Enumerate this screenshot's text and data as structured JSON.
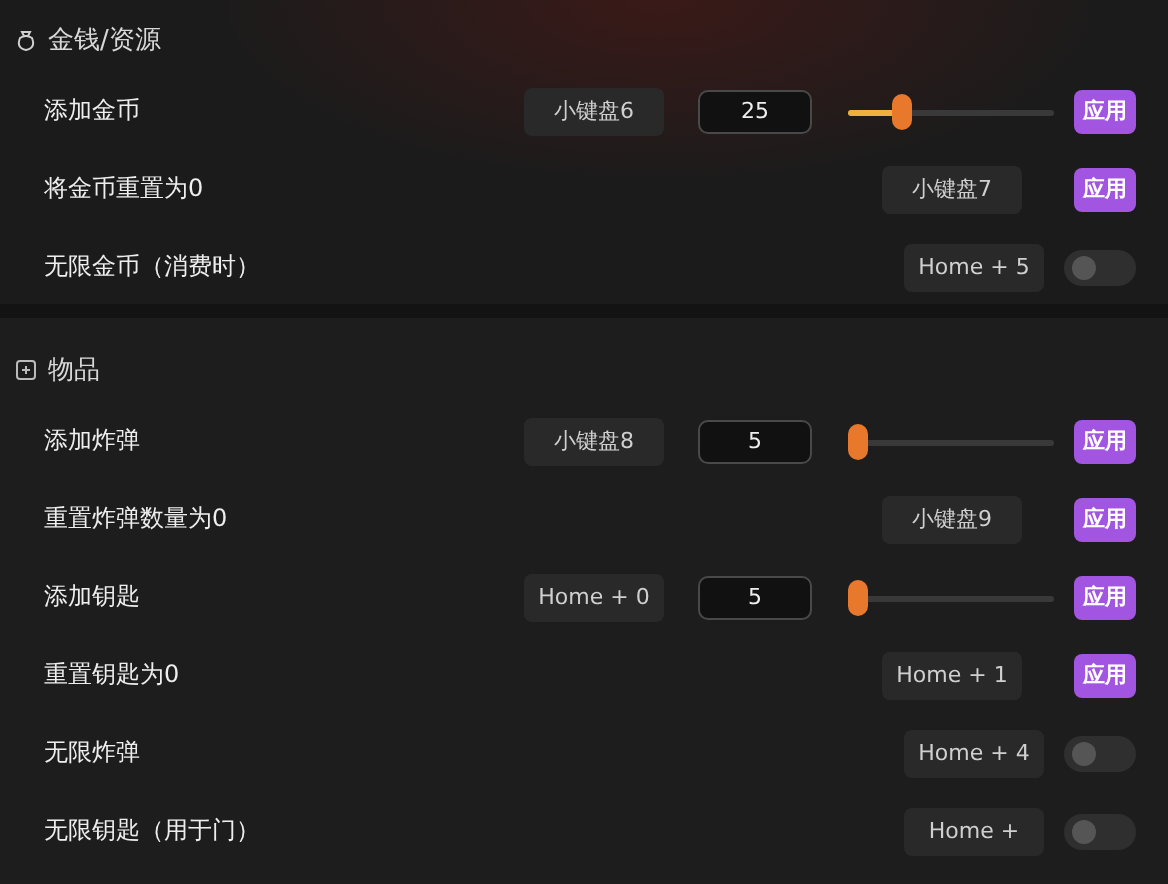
{
  "sections": [
    {
      "title": "金钱/资源",
      "rows": [
        {
          "kind": "slider",
          "label": "添加金币",
          "hotkey": "小键盘6",
          "value": "25",
          "level": 0.24,
          "button": "应用"
        },
        {
          "kind": "apply",
          "label": "将金币重置为0",
          "hotkey": "小键盘7",
          "button": "应用"
        },
        {
          "kind": "toggle",
          "label": "无限金币（消费时）",
          "hotkey": "Home + 5",
          "on": false
        }
      ]
    },
    {
      "title": "物品",
      "rows": [
        {
          "kind": "slider",
          "label": "添加炸弹",
          "hotkey": "小键盘8",
          "value": "5",
          "level": 0,
          "button": "应用"
        },
        {
          "kind": "apply",
          "label": "重置炸弹数量为0",
          "hotkey": "小键盘9",
          "button": "应用"
        },
        {
          "kind": "slider",
          "label": "添加钥匙",
          "hotkey": "Home + 0",
          "value": "5",
          "level": 0,
          "button": "应用"
        },
        {
          "kind": "apply",
          "label": "重置钥匙为0",
          "hotkey": "Home + 1",
          "button": "应用"
        },
        {
          "kind": "toggle",
          "label": "无限炸弹",
          "hotkey": "Home + 4",
          "on": false
        },
        {
          "kind": "toggle",
          "label": "无限钥匙（用于门）",
          "hotkey": "Home +",
          "on": false
        }
      ]
    }
  ]
}
